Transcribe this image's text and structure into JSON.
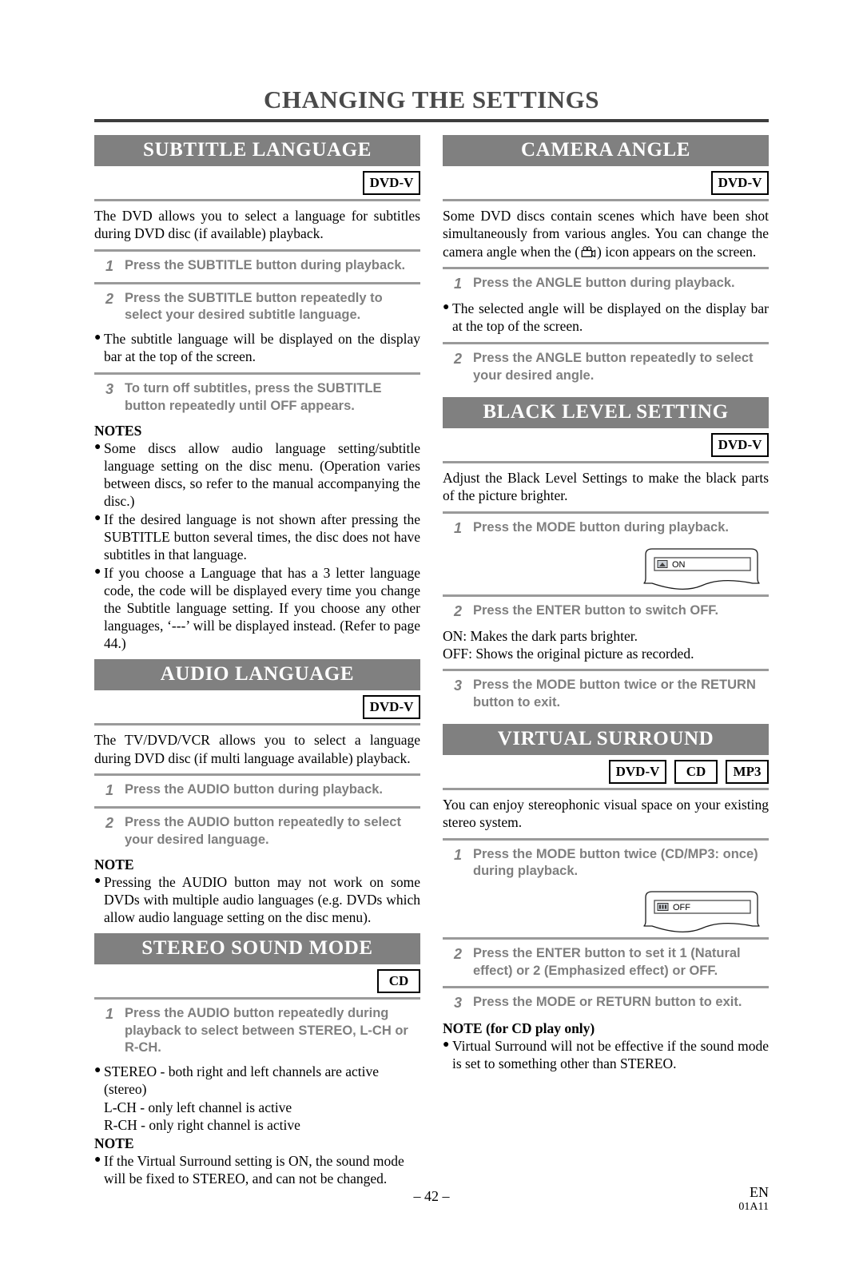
{
  "page": {
    "title": "CHANGING THE SETTINGS",
    "folio": "– 42 –",
    "footer_region": "EN",
    "footer_code": "01A11"
  },
  "badges": {
    "dvd_v": "DVD-V",
    "cd": "CD",
    "mp3": "MP3"
  },
  "labels": {
    "notes": "NOTES",
    "note": "NOTE",
    "note_cd_only": "NOTE (for CD play only)"
  },
  "left_column": {
    "subtitle_language": {
      "heading": "SUBTITLE LANGUAGE",
      "discs": [
        "DVD-V"
      ],
      "intro": "The DVD allows you to select a language for subtitles during DVD disc (if available) playback.",
      "steps": [
        {
          "num": "1",
          "text": "Press the SUBTITLE button during playback."
        },
        {
          "num": "2",
          "text": "Press the SUBTITLE button repeatedly to select your desired subtitle language."
        },
        {
          "num": "3",
          "text": "To turn off subtitles, press the SUBTITLE button repeatedly until OFF appears."
        }
      ],
      "after_step2_bullet": "The subtitle language will be displayed on the display bar at the top of the screen.",
      "notes_heading": "NOTES",
      "notes": [
        "Some discs allow audio language setting/subtitle language setting on the disc menu. (Operation varies between discs, so refer to the manual accompanying the disc.)",
        "If the desired language is not shown after pressing the SUBTITLE button several times, the disc does not have subtitles in that language.",
        "If you choose a Language that has a 3 letter language code, the code will be displayed every time you change the Subtitle language setting. If you choose any other languages, ‘---’ will be displayed instead. (Refer to page 44.)"
      ]
    },
    "audio_language": {
      "heading": "AUDIO LANGUAGE",
      "discs": [
        "DVD-V"
      ],
      "intro": "The TV/DVD/VCR allows you to select a language during DVD disc (if multi language available) playback.",
      "steps": [
        {
          "num": "1",
          "text": "Press the AUDIO button during playback."
        },
        {
          "num": "2",
          "text": "Press the AUDIO button repeatedly to select your desired language."
        }
      ],
      "notes_heading": "NOTE",
      "notes": [
        "Pressing the AUDIO button may not work on some DVDs with multiple audio languages (e.g. DVDs which allow audio language setting on the disc menu)."
      ]
    },
    "stereo_sound_mode": {
      "heading": "STEREO SOUND MODE",
      "discs": [
        "CD"
      ],
      "steps": [
        {
          "num": "1",
          "text": "Press the AUDIO button repeatedly during playback to select between STEREO, L-CH or R-CH."
        }
      ],
      "mode_lines": [
        "STEREO - both right and left channels are active (stereo)",
        "L-CH - only left channel is active",
        "R-CH - only right channel is active"
      ],
      "notes_heading": "NOTE",
      "notes": [
        "If the Virtual Surround setting is ON, the sound mode will be fixed to STEREO, and can not be changed."
      ]
    }
  },
  "right_column": {
    "camera_angle": {
      "heading": "CAMERA ANGLE",
      "discs": [
        "DVD-V"
      ],
      "intro_part1": "Some DVD discs contain scenes which have been shot simultaneously from various angles. You can change the camera angle when the (",
      "intro_icon": "camera-icon",
      "intro_part2": ") icon appears on the screen.",
      "steps": [
        {
          "num": "1",
          "text": "Press the ANGLE button during playback."
        },
        {
          "num": "2",
          "text": "Press the ANGLE button repeatedly to select your desired angle."
        }
      ],
      "after_step1_bullet": "The selected angle will be displayed on the display bar at the top of the screen."
    },
    "black_level_setting": {
      "heading": "BLACK LEVEL SETTING",
      "discs": [
        "DVD-V"
      ],
      "intro": "Adjust the Black Level Settings to make the black parts of the picture brighter.",
      "steps": [
        {
          "num": "1",
          "text": "Press the MODE button during playback."
        },
        {
          "num": "2",
          "text": "Press the ENTER button to switch OFF."
        },
        {
          "num": "3",
          "text": "Press the MODE button twice or the RETURN button to exit."
        }
      ],
      "osd_label": "ON",
      "explain_lines": [
        "ON: Makes the dark parts brighter.",
        "OFF: Shows the original picture as recorded."
      ]
    },
    "virtual_surround": {
      "heading": "VIRTUAL SURROUND",
      "discs": [
        "DVD-V",
        "CD",
        "MP3"
      ],
      "intro": "You can enjoy stereophonic visual space on your existing stereo system.",
      "steps": [
        {
          "num": "1",
          "text": "Press the MODE button twice (CD/MP3: once) during playback."
        },
        {
          "num": "2",
          "text": "Press the ENTER button to set it 1 (Natural effect) or 2 (Emphasized effect) or OFF."
        },
        {
          "num": "3",
          "text": "Press the MODE or RETURN button to exit."
        }
      ],
      "osd_label": "OFF",
      "notes_heading": "NOTE (for CD play only)",
      "notes": [
        "Virtual Surround will not be effective if the sound mode is set to something other than STEREO."
      ]
    }
  },
  "colors": {
    "bar_gray": "#808080",
    "rule_gray": "#9a9a9a",
    "title_gray": "#4a4a4a",
    "step_gray": "#7f7f7f"
  }
}
